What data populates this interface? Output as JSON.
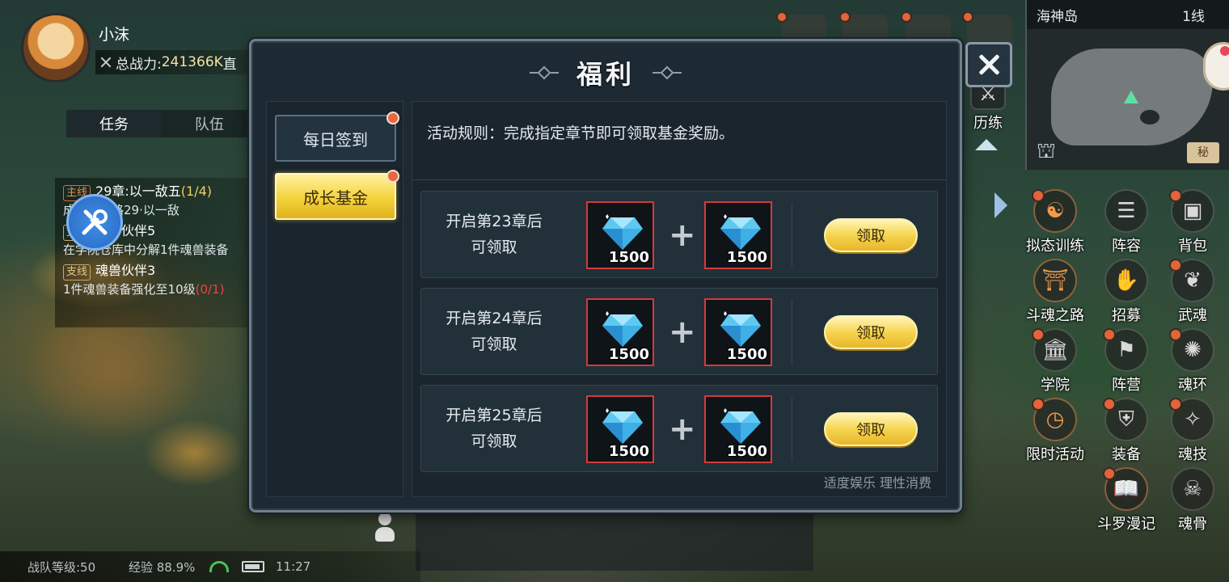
{
  "hud": {
    "player_name": "小沫",
    "power_label": "总战力:",
    "power_value": "241366K",
    "power_suffix": "直",
    "tabs": [
      "任务",
      "队伍"
    ]
  },
  "quests": [
    {
      "tag": "主线",
      "title": "29章:以一敌五",
      "progress": "(1/4)",
      "desc": "成斗魂之路29·以一敌"
    },
    {
      "tag": "支线",
      "title": "魂兽伙伴5",
      "progress": "",
      "desc": "在学院仓库中分解1件魂兽装备"
    },
    {
      "tag": "支线",
      "title": "魂兽伙伴3",
      "progress": "",
      "desc": "1件魂兽装备强化至10级",
      "desc_progress": "(0/1)"
    }
  ],
  "minimap": {
    "location": "海神岛",
    "line": "1线",
    "book_label": "秘"
  },
  "side_menu": {
    "top_label": "历练",
    "items": [
      {
        "label": "拟态训练",
        "icon": "meditate-icon",
        "dot": true
      },
      {
        "label": "阵容",
        "icon": "team-icon",
        "dot": false
      },
      {
        "label": "背包",
        "icon": "backpack-icon",
        "dot": true
      },
      {
        "label": "斗魂之路",
        "icon": "gate-icon",
        "dot": false
      },
      {
        "label": "招募",
        "icon": "recruit-icon",
        "dot": false
      },
      {
        "label": "武魂",
        "icon": "spirit-icon",
        "dot": true
      },
      {
        "label": "学院",
        "icon": "academy-icon",
        "dot": true
      },
      {
        "label": "阵营",
        "icon": "flags-icon",
        "dot": true
      },
      {
        "label": "魂环",
        "icon": "ring-icon",
        "dot": true
      },
      {
        "label": "限时活动",
        "icon": "event-icon",
        "dot": true
      },
      {
        "label": "装备",
        "icon": "armor-icon",
        "dot": true
      },
      {
        "label": "魂技",
        "icon": "skill-icon",
        "dot": true
      },
      {
        "label": "斗罗漫记",
        "icon": "book-icon",
        "dot": true
      },
      {
        "label": "魂骨",
        "icon": "bone-icon",
        "dot": false
      }
    ]
  },
  "status": {
    "team_level": "战队等级:50",
    "exp": "经验 88.9%",
    "time": "11:27"
  },
  "modal": {
    "title": "福利",
    "tabs": [
      {
        "label": "每日签到",
        "active": false,
        "dot": true
      },
      {
        "label": "成长基金",
        "active": true,
        "dot": true
      }
    ],
    "rule": "活动规则：完成指定章节即可领取基金奖励。",
    "rows": [
      {
        "cond_line1": "开启第23章后",
        "cond_line2": "可领取",
        "items": [
          {
            "icon": "diamond-icon",
            "count": "1500"
          },
          {
            "icon": "diamond-icon",
            "count": "1500"
          }
        ],
        "button": "领取"
      },
      {
        "cond_line1": "开启第24章后",
        "cond_line2": "可领取",
        "items": [
          {
            "icon": "diamond-icon",
            "count": "1500"
          },
          {
            "icon": "diamond-icon",
            "count": "1500"
          }
        ],
        "button": "领取"
      },
      {
        "cond_line1": "开启第25章后",
        "cond_line2": "可领取",
        "items": [
          {
            "icon": "diamond-icon",
            "count": "1500"
          },
          {
            "icon": "diamond-icon",
            "count": "1500"
          }
        ],
        "button": "领取"
      }
    ],
    "plus": "+",
    "footer": "适度娱乐  理性消费"
  },
  "colors": {
    "accent_gold": "#f3d23a",
    "notify_dot": "#e8673f",
    "slot_border": "#d43a3a",
    "panel_bg": "#1b252d"
  }
}
